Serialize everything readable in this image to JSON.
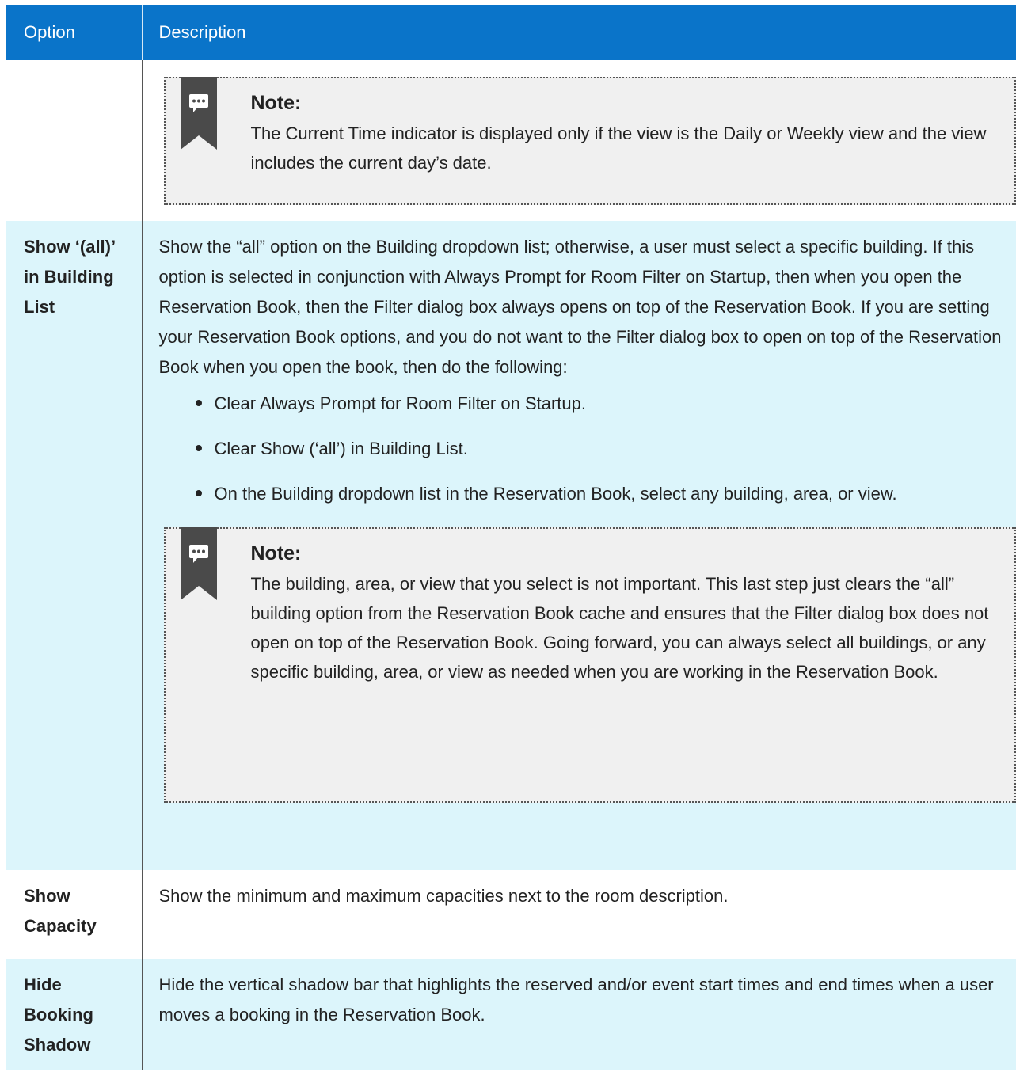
{
  "header": {
    "col1": "Option",
    "col2": "Description"
  },
  "rows": [
    {
      "option": "",
      "note": {
        "title": "Note:",
        "body": "The Current Time indicator is displayed only if the view is the Daily or Weekly view and the view includes the current day’s date."
      }
    },
    {
      "option": "Show ‘(all)’ in Building List",
      "description": "Show the “all” option on the Building dropdown list; otherwise, a user must select a specific building. If this option is selected in conjunction with Always Prompt for Room Filter on Startup, then when you open the Reservation Book, then the Filter dialog box always opens on top of the Reservation Book. If you are setting your Reservation Book options, and you do not want to the Filter dialog box to open on top of the Reservation Book when you open the book, then do the following:",
      "steps": [
        "Clear Always Prompt for Room Filter on Startup.",
        "Clear Show (‘all’) in Building List.",
        "On the Building dropdown list in the Reservation Book, select any building, area, or view."
      ],
      "note": {
        "title": "Note:",
        "body": "The building, area, or view that you select is not important. This last step just clears the “all” building option from the Reservation Book cache and ensures that the Filter dialog box does not open on top of the Reservation Book. Going forward, you can always select all buildings, or any specific building, area, or view as needed when you are working in the Reservation Book."
      }
    },
    {
      "option": "Show Capacity",
      "description": "Show the minimum and maximum capacities next to the room description."
    },
    {
      "option": "Hide Booking Shadow",
      "description": "Hide the vertical shadow bar that highlights the reserved and/or event start times and end times when a user moves a booking in the Reservation Book."
    }
  ],
  "icons": {
    "note": "note-comment-flag-icon"
  },
  "colors": {
    "header_bg": "#0a74c9",
    "row_alt_bg": "#dcf5fb",
    "note_bg": "#f0f0f0"
  }
}
